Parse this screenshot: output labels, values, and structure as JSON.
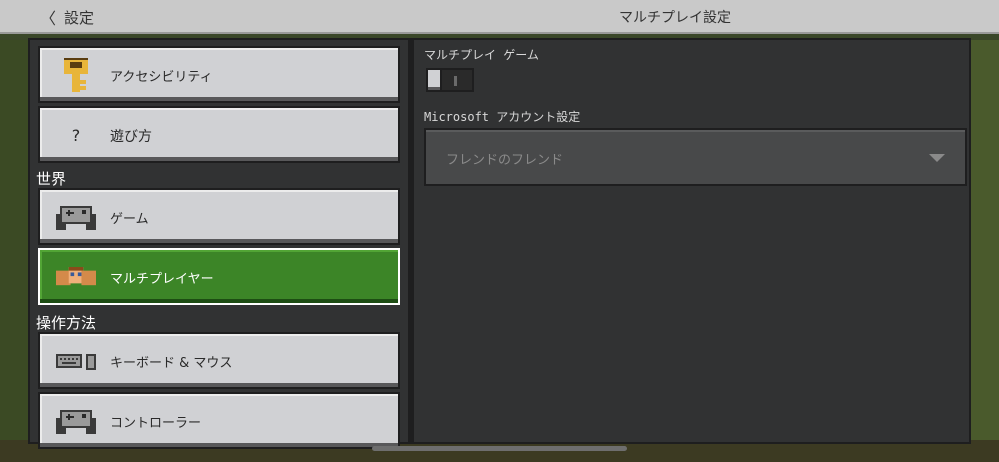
{
  "header": {
    "back_label": "設定",
    "title": "マルチプレイ設定"
  },
  "sidebar": {
    "items": [
      {
        "label": "アクセシビリティ",
        "icon": "key-icon"
      },
      {
        "label": "遊び方",
        "icon": "question-icon",
        "glyph": "?"
      },
      {
        "label": "ゲーム",
        "icon": "controller-icon"
      },
      {
        "label": "マルチプレイヤー",
        "icon": "players-icon"
      },
      {
        "label": "キーボード & マウス",
        "icon": "keyboard-mouse-icon"
      },
      {
        "label": "コントローラー",
        "icon": "controller-icon"
      }
    ],
    "sections": {
      "world": "世界",
      "controls": "操作方法"
    }
  },
  "main": {
    "multiplayer_game_label": "マルチプレイ ゲーム",
    "multiplayer_game_enabled": false,
    "account_settings_label": "Microsoft アカウント設定",
    "friends_dropdown_value": "フレンドのフレンド"
  },
  "colors": {
    "selected": "#3c8527",
    "button": "#d0d1d4",
    "panel": "#313233"
  }
}
